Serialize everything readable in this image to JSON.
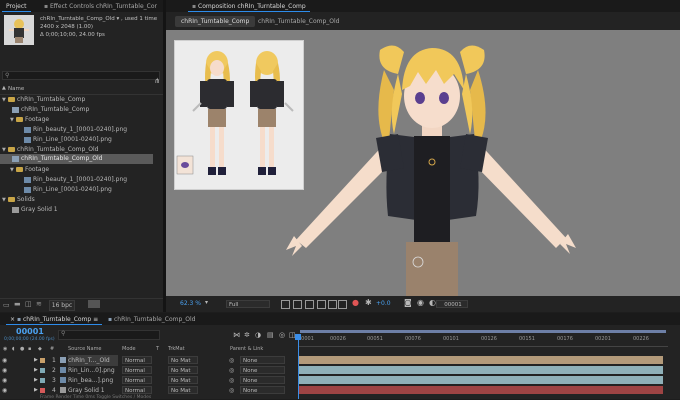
{
  "project_panel": {
    "tab_project": "Project",
    "tab_effect_controls": "Effect Controls chRIn_Turntable_Cor",
    "item_name": "chRIn_Turntable_Comp_Old",
    "used_text": ", used 1 time",
    "dimensions": "2400 x 2048 (1.00)",
    "duration": "Δ 0;00;10;00, 24.00 fps",
    "search_placeholder": "",
    "name_header": "Name",
    "bpc": "16 bpc",
    "items": [
      {
        "label": "chRIn_Turntable_Comp",
        "type": "folder",
        "level": 0
      },
      {
        "label": "chRIn_Turntable_Comp",
        "type": "comp",
        "level": 1
      },
      {
        "label": "Footage",
        "type": "folder",
        "level": 1
      },
      {
        "label": "Rin_beauty_1_[0001-0240].png",
        "type": "image",
        "level": 2
      },
      {
        "label": "Rin_Line_[0001-0240].png",
        "type": "image",
        "level": 2
      },
      {
        "label": "chRIn_Turntable_Comp_Old",
        "type": "folder",
        "level": 0
      },
      {
        "label": "chRIn_Turntable_Comp_Old",
        "type": "comp",
        "level": 1
      },
      {
        "label": "Footage",
        "type": "folder",
        "level": 1
      },
      {
        "label": "Rin_beauty_1_[0001-0240].png",
        "type": "image",
        "level": 2
      },
      {
        "label": "Rin_Line_[0001-0240].png",
        "type": "image",
        "level": 2
      },
      {
        "label": "Solids",
        "type": "folder",
        "level": 0
      },
      {
        "label": "Gray Solid 1",
        "type": "solid",
        "level": 1
      }
    ]
  },
  "composition_panel": {
    "tab_title": "Composition chRIn_Turntable_Comp",
    "sub_tab_active": "chRIn_Turntable_Comp",
    "sub_tab_other": "chRIn_Turntable_Comp_Old",
    "zoom": "62.3 %",
    "resolution": "Full",
    "exposure": "+0.0",
    "timecode": "00001"
  },
  "timeline": {
    "tab_active": "chRIn_Turntable_Comp",
    "tab_other": "chRIn_Turntable_Comp_Old",
    "current_frame": "00001",
    "current_time": "0;00;00;00 (24.00 fps)",
    "columns": {
      "source_name": "Source Name",
      "mode": "Mode",
      "t": "T",
      "trkmat": "TrkMat",
      "parent": "Parent & Link"
    },
    "ruler": [
      "00001",
      "00026",
      "00051",
      "00076",
      "00101",
      "00126",
      "00151",
      "00176",
      "00201",
      "00226"
    ],
    "layers": [
      {
        "num": "1",
        "name": "chRIn_T..._Old",
        "mode": "Normal",
        "trkmat": "No Mat",
        "parent": "None",
        "label_color": "#c9a06a",
        "bar_color": "#b39a7a"
      },
      {
        "num": "2",
        "name": "Rin_Lin...0].png",
        "mode": "Normal",
        "trkmat": "No Mat",
        "parent": "None",
        "label_color": "#7faab5",
        "bar_color": "#8fb0b8"
      },
      {
        "num": "3",
        "name": "Rin_bea...].png",
        "mode": "Normal",
        "trkmat": "No Mat",
        "parent": "None",
        "label_color": "#7faab5",
        "bar_color": "#8fb0b8"
      },
      {
        "num": "4",
        "name": "Gray Solid 1",
        "mode": "Normal",
        "trkmat": "No Mat",
        "parent": "None",
        "label_color": "#d65a5a",
        "bar_color": "#9e4444"
      }
    ],
    "footer": "Frame Render Time  0ms        Toggle Switches / Modes"
  }
}
